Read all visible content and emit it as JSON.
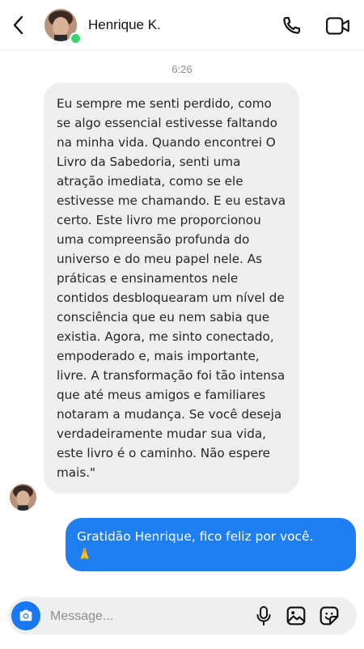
{
  "header": {
    "contact_name": "Henrique K.",
    "online": true
  },
  "conversation": {
    "timestamp": "6:26",
    "messages": [
      {
        "direction": "incoming",
        "text": "Eu sempre me senti perdido, como se algo essencial estivesse faltando na minha vida. Quando encontrei O Livro da Sabedoria, senti uma atração imediata, como se ele estivesse me chamando. E eu estava certo. Este livro me proporcionou uma compreensão profunda do universo e do meu papel nele. As práticas e ensinamentos nele contidos desbloquearam um nível de consciência que eu nem sabia que existia. Agora, me sinto conectado, empoderado e, mais importante, livre. A transformação foi tão intensa que até meus amigos e familiares notaram a mudança. Se você deseja verdadeiramente mudar sua vida, este livro é o caminho. Não espere mais.\""
      },
      {
        "direction": "outgoing",
        "text": "Gratidão Henrique, fico feliz por você.",
        "emoji": "🙏"
      }
    ]
  },
  "composer": {
    "placeholder": "Message..."
  },
  "colors": {
    "outgoing_bubble": "#1f7ff0",
    "incoming_bubble": "#efefef",
    "online_dot": "#3bd16f",
    "camera_button": "#1877f2"
  },
  "icons": {
    "back": "chevron-left-icon",
    "phone": "phone-icon",
    "video": "video-camera-icon",
    "camera": "camera-icon",
    "mic": "microphone-icon",
    "gallery": "image-icon",
    "sticker": "sticker-icon"
  }
}
